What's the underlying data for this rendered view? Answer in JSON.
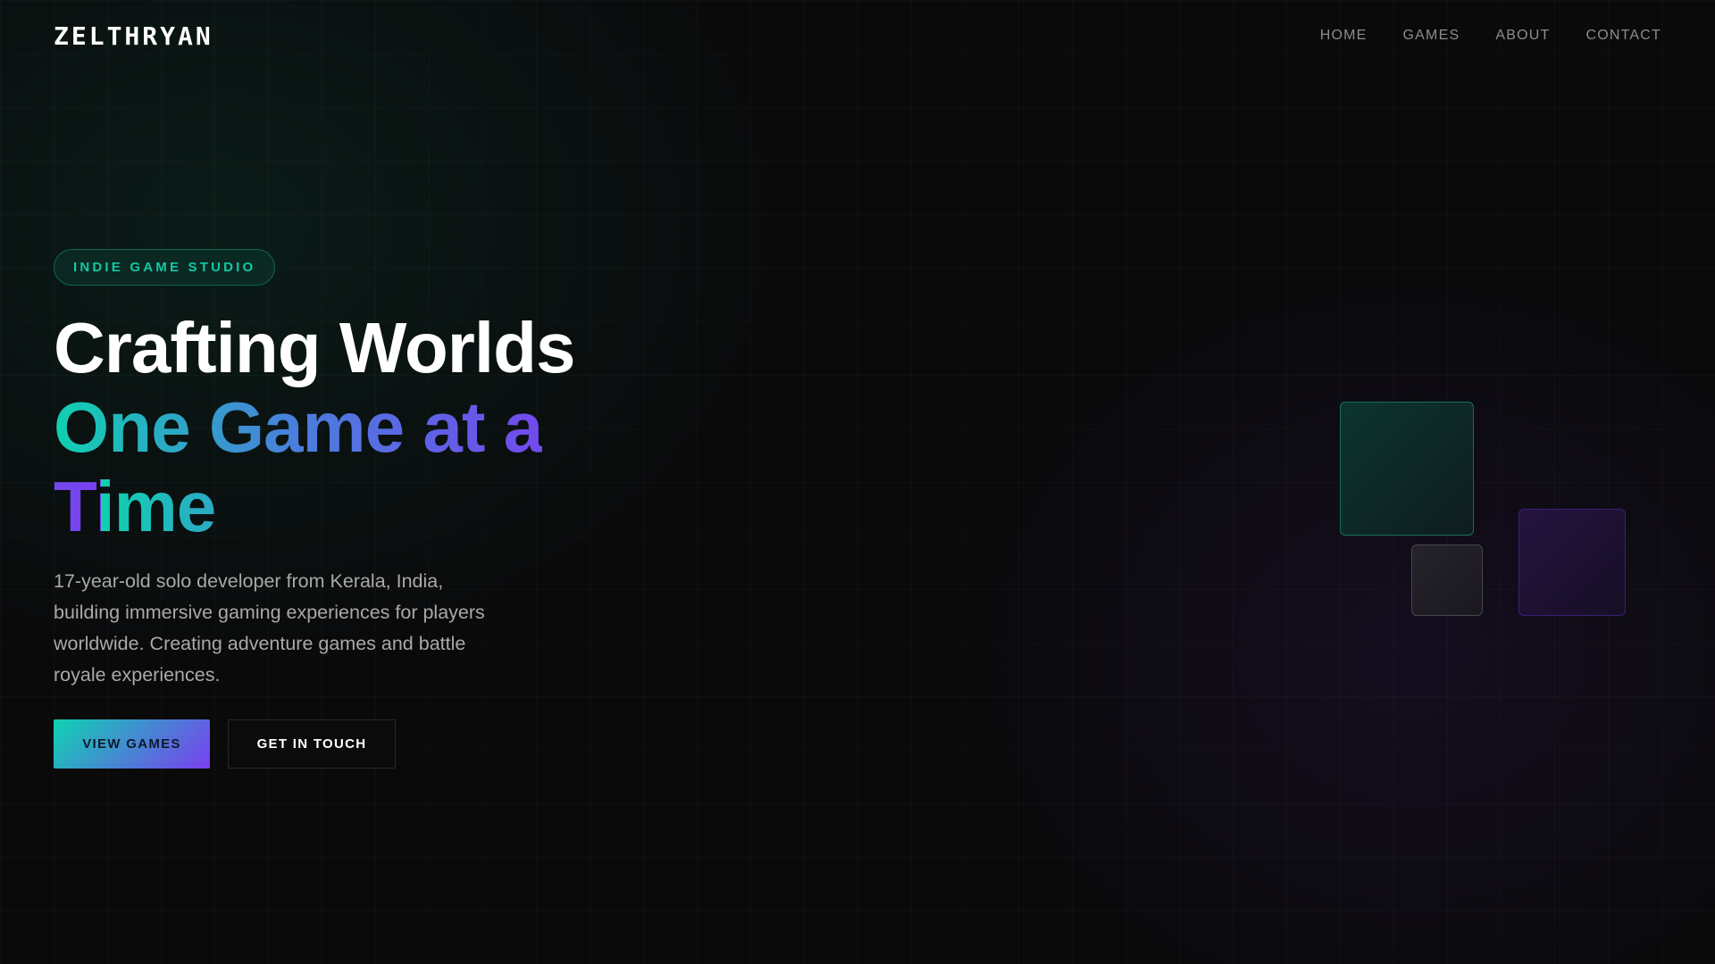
{
  "brand": {
    "logo": "ZELTHRYAN"
  },
  "nav": {
    "items": [
      {
        "label": "HOME"
      },
      {
        "label": "GAMES"
      },
      {
        "label": "ABOUT"
      },
      {
        "label": "CONTACT"
      }
    ]
  },
  "hero": {
    "badge": "INDIE GAME STUDIO",
    "title_line1": "Crafting Worlds",
    "title_line2": "One Game at a Time",
    "description": "17-year-old solo developer from Kerala, India, building immersive gaming experiences for players worldwide. Creating adventure games and battle royale experiences.",
    "primary_button": "VIEW GAMES",
    "secondary_button": "GET IN TOUCH"
  },
  "colors": {
    "accent_teal": "#10d0b0",
    "accent_purple": "#7a3ff0",
    "background": "#0a0a0b"
  }
}
